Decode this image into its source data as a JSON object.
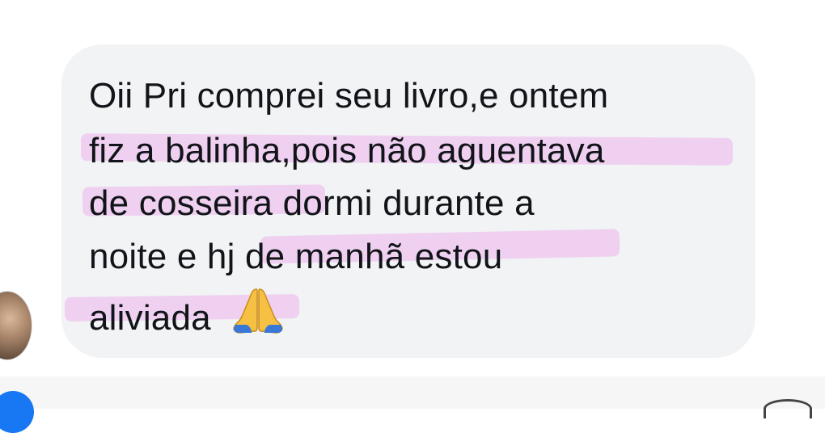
{
  "message": {
    "lines": [
      "Oii Pri comprei seu livro,e ontem",
      "fiz a balinha,pois não aguentava",
      "de cosseira dormi durante a",
      "noite e hj de manhã estou",
      "aliviada"
    ],
    "emoji": "folded-hands",
    "highlight_color": "#eeccf0",
    "bubble_color": "#f2f3f5",
    "text_color": "#111418"
  },
  "composer": {
    "accent_color": "#1877f2"
  }
}
